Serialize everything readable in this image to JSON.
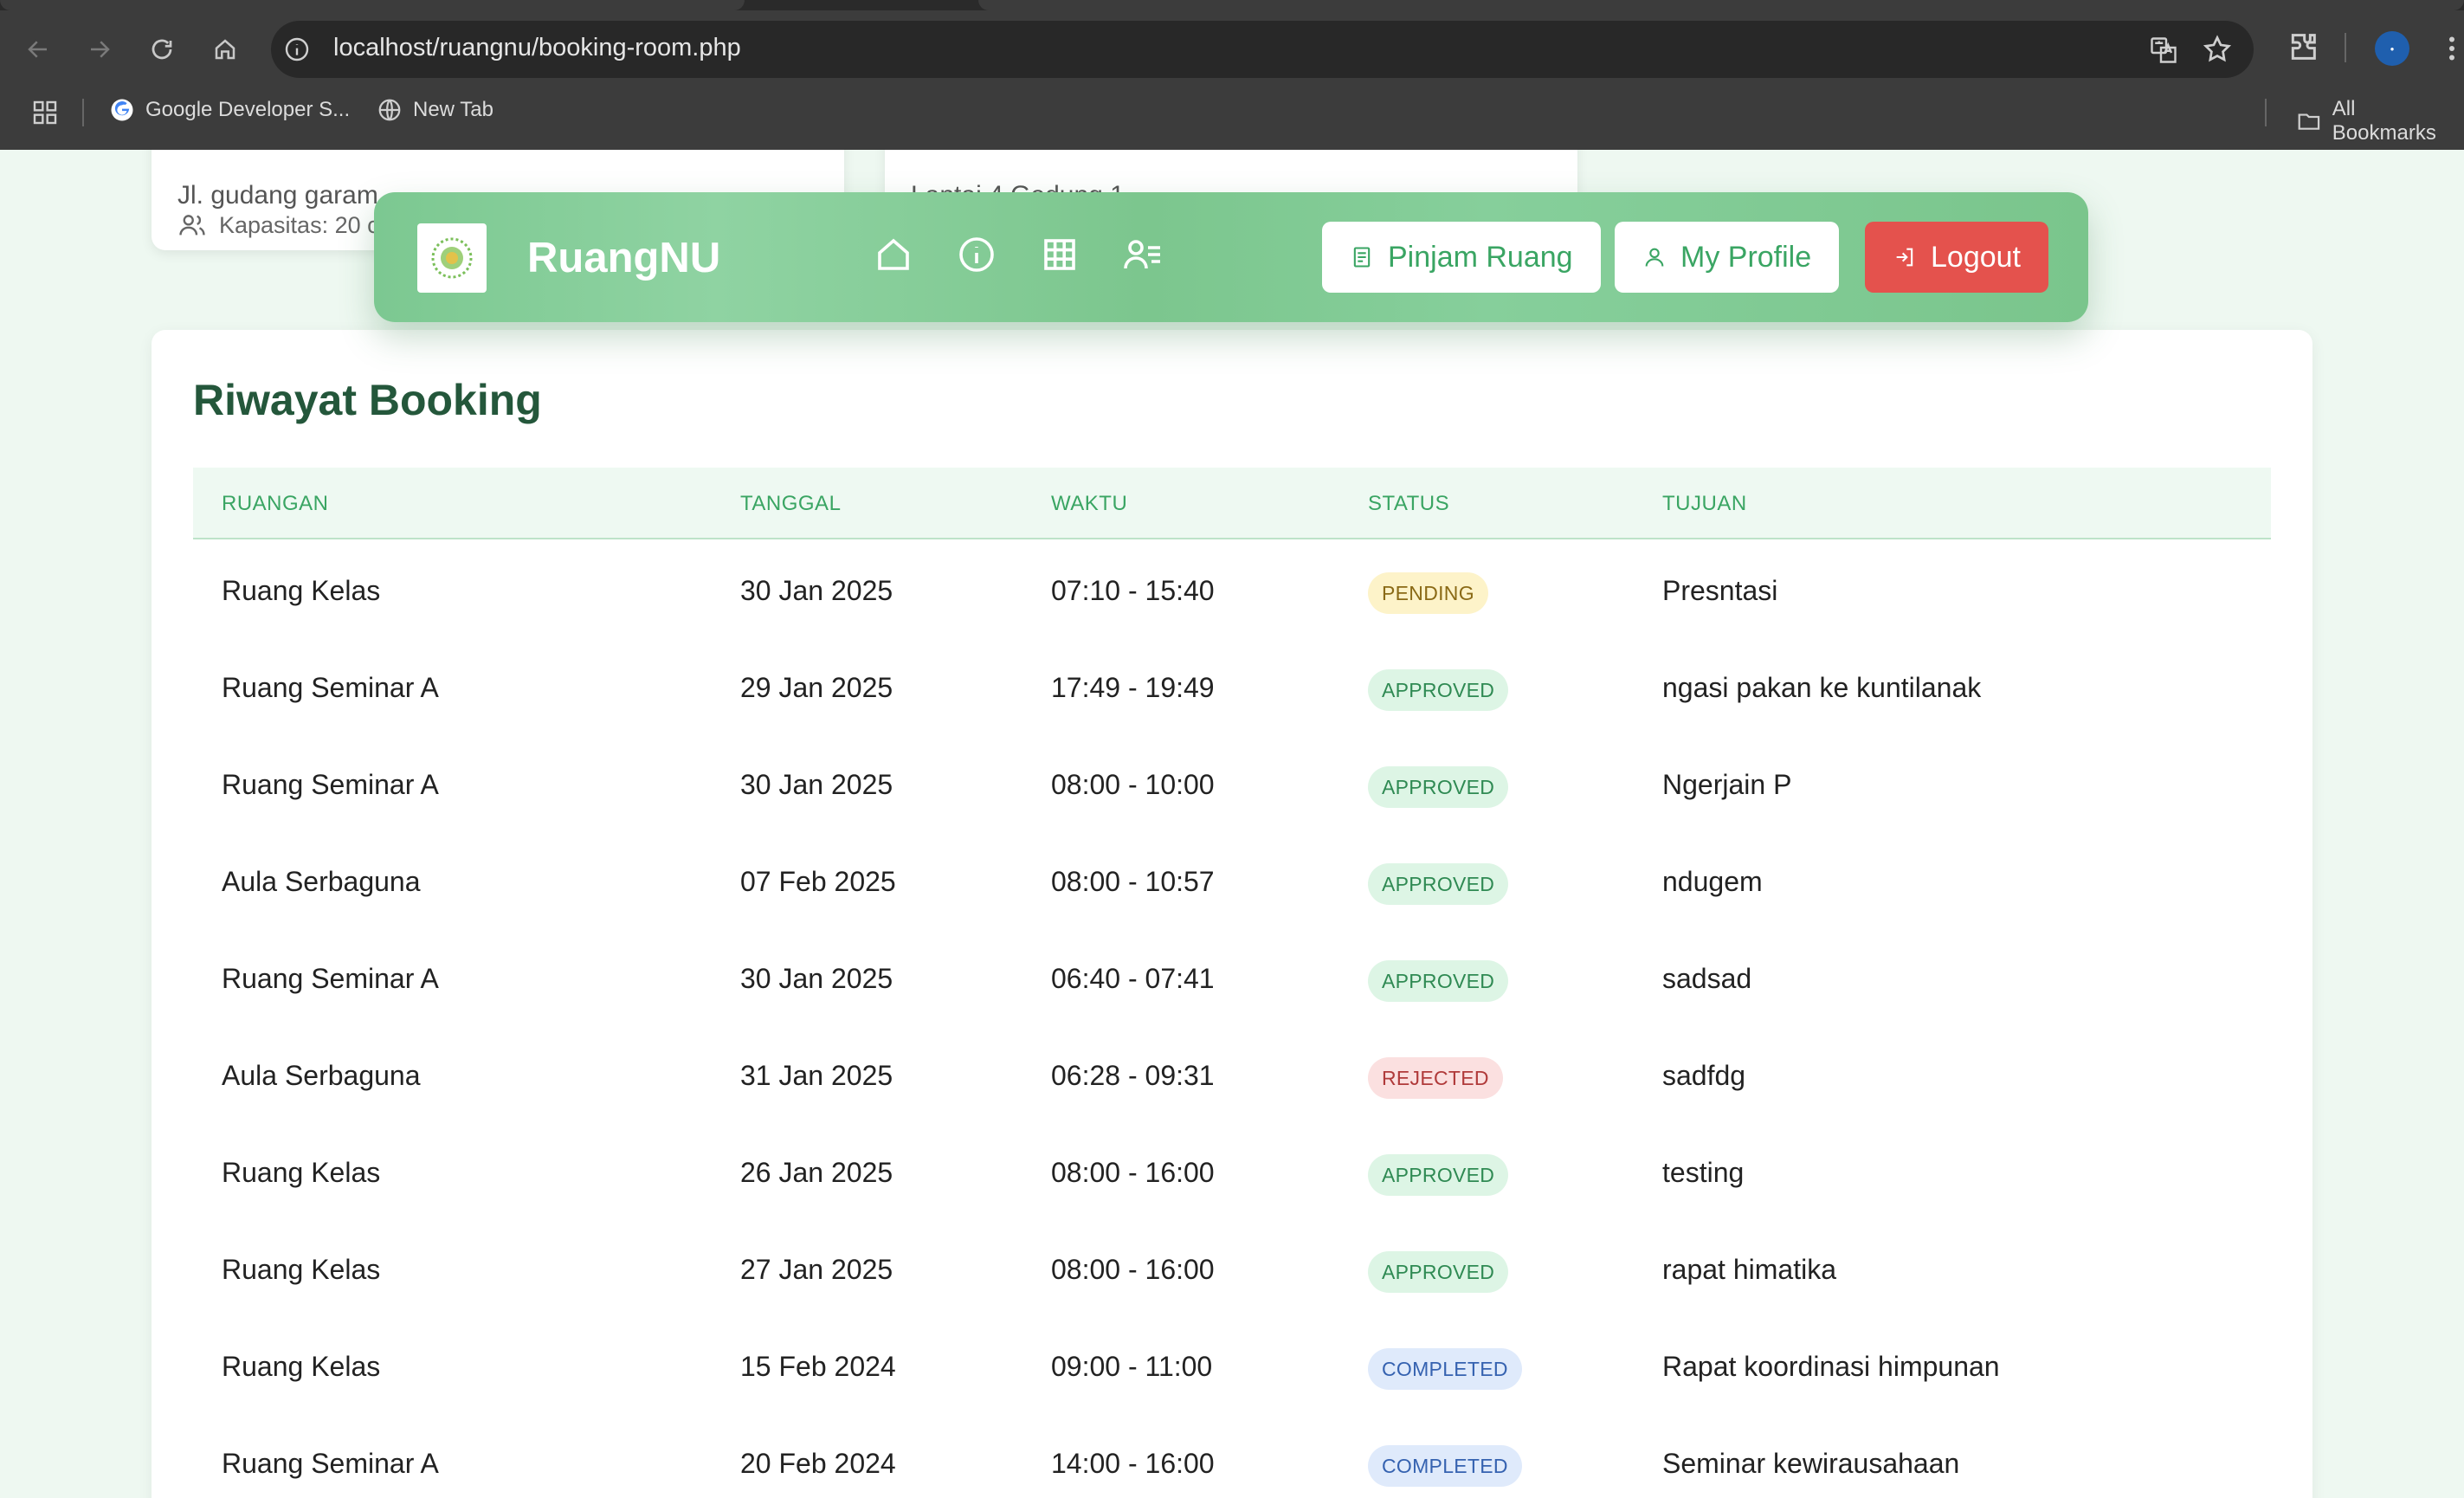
{
  "browser": {
    "url": "localhost/ruangnu/booking-room.php",
    "bookmarks": [
      "Google Developer S...",
      "New Tab"
    ],
    "all_bookmarks": "All Bookmarks"
  },
  "cards": {
    "a_address": "Jl. gudang garam",
    "a_capacity": "Kapasitas: 20 c",
    "b_address": "Lantai 4 Gedung 1"
  },
  "navbar": {
    "brand": "RuangNU",
    "buttons": {
      "pinjam": "Pinjam Ruang",
      "profile": "My Profile",
      "logout": "Logout"
    }
  },
  "history": {
    "title": "Riwayat Booking",
    "headers": [
      "RUANGAN",
      "TANGGAL",
      "WAKTU",
      "STATUS",
      "TUJUAN"
    ],
    "rows": [
      {
        "room": "Ruang Kelas",
        "date": "30 Jan 2025",
        "time": "07:10 - 15:40",
        "status": "PENDING",
        "purpose": "Presntasi"
      },
      {
        "room": "Ruang Seminar A",
        "date": "29 Jan 2025",
        "time": "17:49 - 19:49",
        "status": "APPROVED",
        "purpose": "ngasi pakan ke kuntilanak"
      },
      {
        "room": "Ruang Seminar A",
        "date": "30 Jan 2025",
        "time": "08:00 - 10:00",
        "status": "APPROVED",
        "purpose": "Ngerjain P"
      },
      {
        "room": "Aula Serbaguna",
        "date": "07 Feb 2025",
        "time": "08:00 - 10:57",
        "status": "APPROVED",
        "purpose": "ndugem"
      },
      {
        "room": "Ruang Seminar A",
        "date": "30 Jan 2025",
        "time": "06:40 - 07:41",
        "status": "APPROVED",
        "purpose": "sadsad"
      },
      {
        "room": "Aula Serbaguna",
        "date": "31 Jan 2025",
        "time": "06:28 - 09:31",
        "status": "REJECTED",
        "purpose": "sadfdg"
      },
      {
        "room": "Ruang Kelas",
        "date": "26 Jan 2025",
        "time": "08:00 - 16:00",
        "status": "APPROVED",
        "purpose": "testing"
      },
      {
        "room": "Ruang Kelas",
        "date": "27 Jan 2025",
        "time": "08:00 - 16:00",
        "status": "APPROVED",
        "purpose": "rapat himatika"
      },
      {
        "room": "Ruang Kelas",
        "date": "15 Feb 2024",
        "time": "09:00 - 11:00",
        "status": "COMPLETED",
        "purpose": "Rapat koordinasi himpunan"
      },
      {
        "room": "Ruang Seminar A",
        "date": "20 Feb 2024",
        "time": "14:00 - 16:00",
        "status": "COMPLETED",
        "purpose": "Seminar kewirausahaan"
      }
    ]
  }
}
